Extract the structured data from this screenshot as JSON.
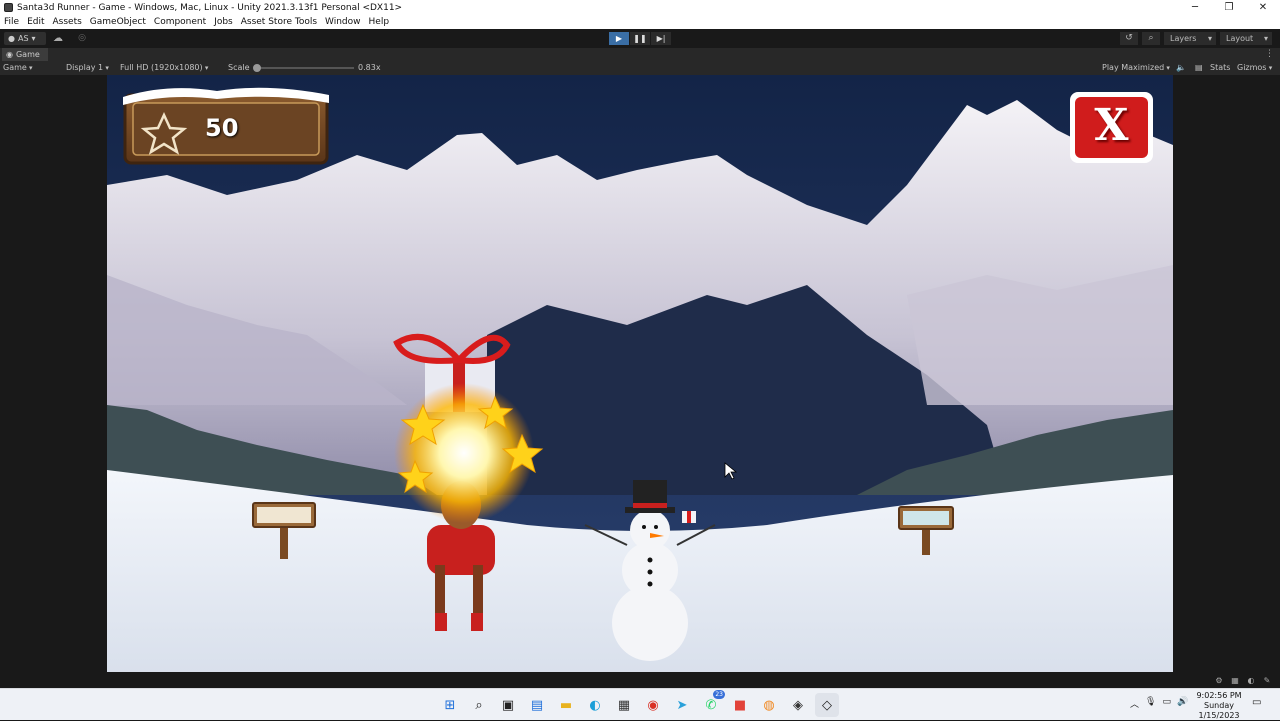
{
  "window": {
    "title": "Santa3d Runner - Game - Windows, Mac, Linux - Unity 2021.3.13f1 Personal <DX11>"
  },
  "menu": [
    "File",
    "Edit",
    "Assets",
    "GameObject",
    "Component",
    "Jobs",
    "Asset Store Tools",
    "Window",
    "Help"
  ],
  "toolbar": {
    "account_label": "AS",
    "layers_label": "Layers",
    "layout_label": "Layout"
  },
  "game_tab": {
    "tab_label": "Game"
  },
  "game_bar": {
    "view_mode": "Game",
    "display": "Display 1",
    "resolution": "Full HD (1920x1080)",
    "scale_label": "Scale",
    "scale_value": "0.83x",
    "scale_fraction": 0.0,
    "play_mode": "Play Maximized",
    "stats_label": "Stats",
    "gizmos_label": "Gizmos"
  },
  "hud": {
    "score": "50",
    "close_label": "X"
  },
  "taskbar": {
    "whatsapp_badge": "23",
    "time": "9:02:56 PM",
    "day": "Sunday",
    "date": "1/15/2023"
  },
  "colors": {
    "sky_top": "#132447",
    "snow": "#eef2f8",
    "close_button": "#d01c1c",
    "board_wood": "#6b4423"
  }
}
